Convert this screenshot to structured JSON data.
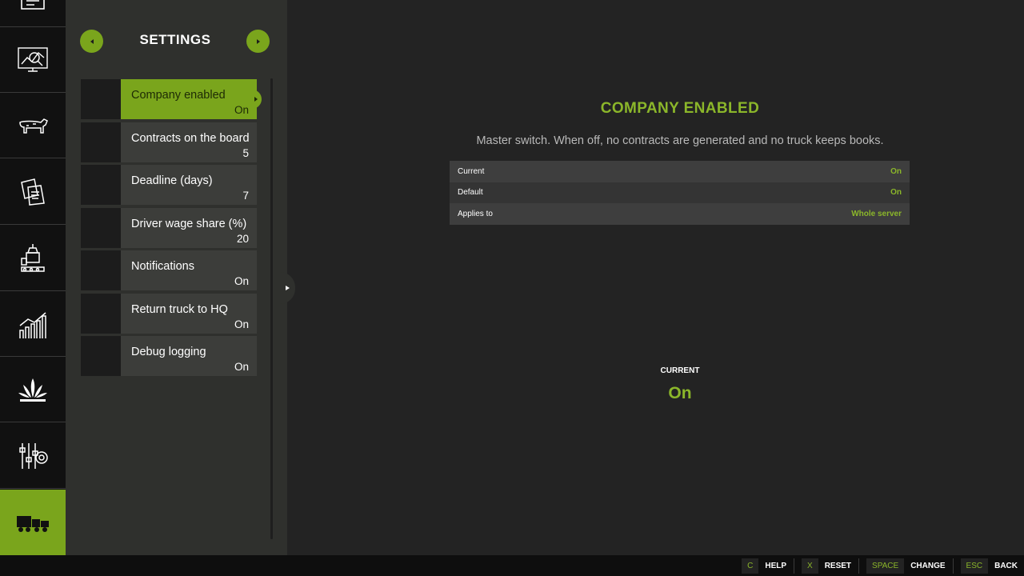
{
  "rail": {
    "items": [
      {
        "icon": "map-icon"
      },
      {
        "icon": "analytics-icon"
      },
      {
        "icon": "animals-icon"
      },
      {
        "icon": "contracts-icon"
      },
      {
        "icon": "production-icon"
      },
      {
        "icon": "statistics-icon"
      },
      {
        "icon": "crops-icon"
      },
      {
        "icon": "settings-sliders-icon"
      },
      {
        "icon": "truck-icon",
        "active": true
      }
    ]
  },
  "panel": {
    "title": "SETTINGS",
    "items": [
      {
        "label": "Company enabled",
        "value": "On",
        "selected": true
      },
      {
        "label": "Contracts on the board",
        "value": "5"
      },
      {
        "label": "Deadline (days)",
        "value": "7"
      },
      {
        "label": "Driver wage share (%)",
        "value": "20"
      },
      {
        "label": "Notifications",
        "value": "On"
      },
      {
        "label": "Return truck to HQ",
        "value": "On"
      },
      {
        "label": "Debug logging",
        "value": "On"
      }
    ]
  },
  "detail": {
    "title": "COMPANY ENABLED",
    "description": "Master switch. When off, no contracts are generated and no truck keeps books.",
    "table": [
      {
        "key": "Current",
        "value": "On"
      },
      {
        "key": "Default",
        "value": "On"
      },
      {
        "key": "Applies to",
        "value": "Whole server"
      }
    ],
    "current_label": "CURRENT",
    "current_value": "On"
  },
  "hints": [
    {
      "key": "C",
      "action": "HELP"
    },
    {
      "key": "X",
      "action": "RESET"
    },
    {
      "key": "SPACE",
      "action": "CHANGE"
    },
    {
      "key": "ESC",
      "action": "BACK"
    }
  ],
  "colors": {
    "accent": "#7aa51c",
    "accent_text": "#8bb62a",
    "panel": "#2f302d",
    "background": "#232323"
  }
}
